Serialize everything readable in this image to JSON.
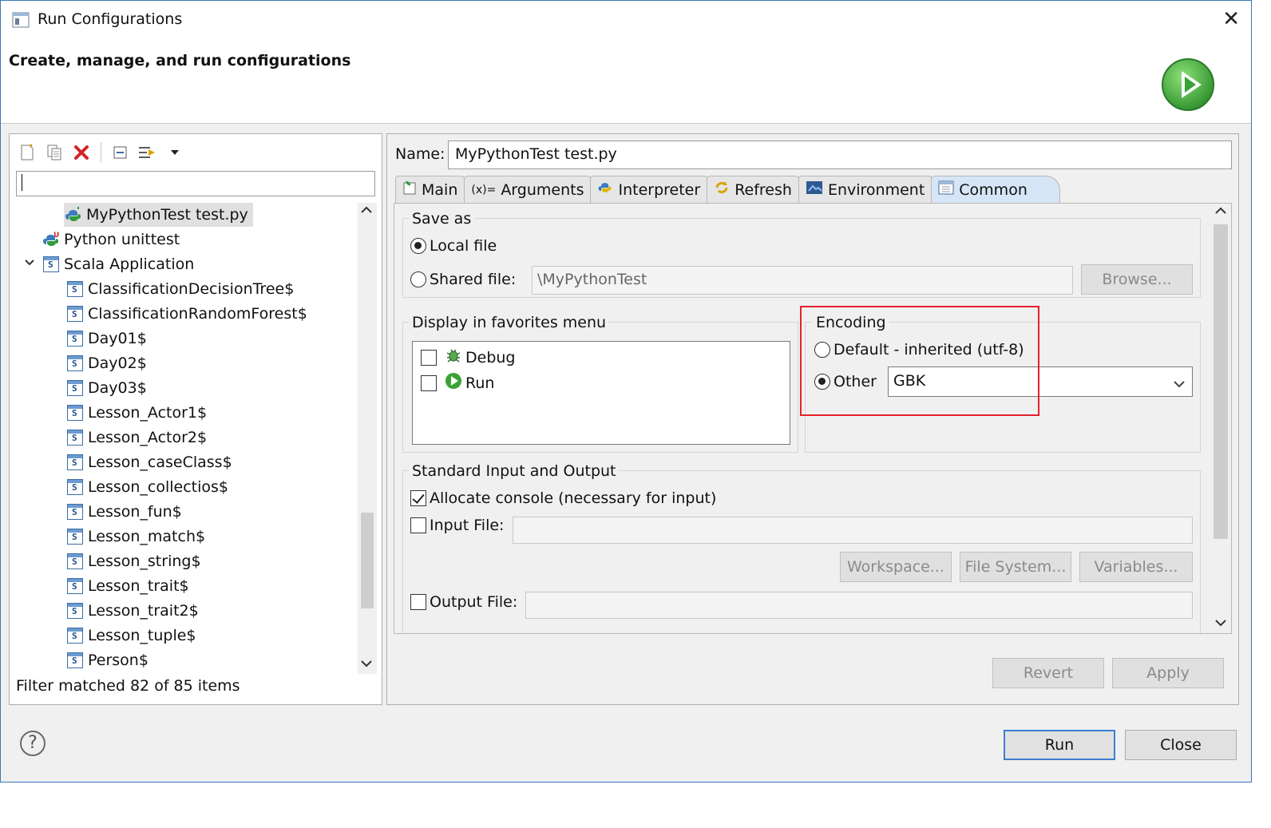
{
  "window": {
    "title": "Run Configurations",
    "heading": "Create, manage, and run configurations"
  },
  "left": {
    "filter_value": "",
    "tree": [
      {
        "label": "MyPythonTest test.py",
        "icon": "python-run-icon",
        "level": 2,
        "selected": true
      },
      {
        "label": "Python unittest",
        "icon": "python-unittest-icon",
        "level": 1
      },
      {
        "label": "Scala Application",
        "icon": "scala-app-icon",
        "level": 1,
        "expanded": true
      },
      {
        "label": "ClassificationDecisionTree$",
        "icon": "scala-class-icon",
        "level": 2
      },
      {
        "label": "ClassificationRandomForest$",
        "icon": "scala-class-icon",
        "level": 2
      },
      {
        "label": "Day01$",
        "icon": "scala-class-icon",
        "level": 2
      },
      {
        "label": "Day02$",
        "icon": "scala-class-icon",
        "level": 2
      },
      {
        "label": "Day03$",
        "icon": "scala-class-icon",
        "level": 2
      },
      {
        "label": "Lesson_Actor1$",
        "icon": "scala-class-icon",
        "level": 2
      },
      {
        "label": "Lesson_Actor2$",
        "icon": "scala-class-icon",
        "level": 2
      },
      {
        "label": "Lesson_caseClass$",
        "icon": "scala-class-icon",
        "level": 2
      },
      {
        "label": "Lesson_collectios$",
        "icon": "scala-class-icon",
        "level": 2
      },
      {
        "label": "Lesson_fun$",
        "icon": "scala-class-icon",
        "level": 2
      },
      {
        "label": "Lesson_match$",
        "icon": "scala-class-icon",
        "level": 2
      },
      {
        "label": "Lesson_string$",
        "icon": "scala-class-icon",
        "level": 2
      },
      {
        "label": "Lesson_trait$",
        "icon": "scala-class-icon",
        "level": 2
      },
      {
        "label": "Lesson_trait2$",
        "icon": "scala-class-icon",
        "level": 2
      },
      {
        "label": "Lesson_tuple$",
        "icon": "scala-class-icon",
        "level": 2
      },
      {
        "label": "Person$",
        "icon": "scala-class-icon",
        "level": 2
      }
    ],
    "status": "Filter matched 82 of 85 items"
  },
  "right": {
    "name_label": "Name:",
    "name_value": "MyPythonTest test.py",
    "tabs": [
      {
        "label": "Main",
        "icon": "main-tab-icon"
      },
      {
        "label": "Arguments",
        "icon": "arguments-tab-icon",
        "prefix": "(x)="
      },
      {
        "label": "Interpreter",
        "icon": "python-tab-icon"
      },
      {
        "label": "Refresh",
        "icon": "refresh-tab-icon"
      },
      {
        "label": "Environment",
        "icon": "environment-tab-icon"
      },
      {
        "label": "Common",
        "icon": "common-tab-icon",
        "active": true
      }
    ],
    "save_as": {
      "title": "Save as",
      "local_file": "Local file",
      "shared_file": "Shared file:",
      "shared_value": "\\MyPythonTest",
      "browse": "Browse...",
      "selected": "local"
    },
    "favorites": {
      "title": "Display in favorites menu",
      "items": [
        {
          "label": "Debug",
          "checked": false,
          "icon": "debug-icon"
        },
        {
          "label": "Run",
          "checked": false,
          "icon": "run-icon"
        }
      ]
    },
    "encoding": {
      "title": "Encoding",
      "default_label": "Default - inherited (utf-8)",
      "other_label": "Other",
      "other_value": "GBK",
      "selected": "other",
      "highlight_color": "#e8202a"
    },
    "std_io": {
      "title": "Standard Input and Output",
      "allocate_console": "Allocate console (necessary for input)",
      "allocate_checked": true,
      "input_file": "Input File:",
      "input_checked": false,
      "workspace": "Workspace...",
      "file_system": "File System...",
      "variables": "Variables...",
      "output_file": "Output File:",
      "output_checked": false
    },
    "revert": "Revert",
    "apply": "Apply"
  },
  "footer": {
    "help": "?",
    "run": "Run",
    "close": "Close"
  },
  "colors": {
    "run_green": "#3aa335",
    "close_red": "#d4232b",
    "accent_blue": "#3c7fd1"
  }
}
